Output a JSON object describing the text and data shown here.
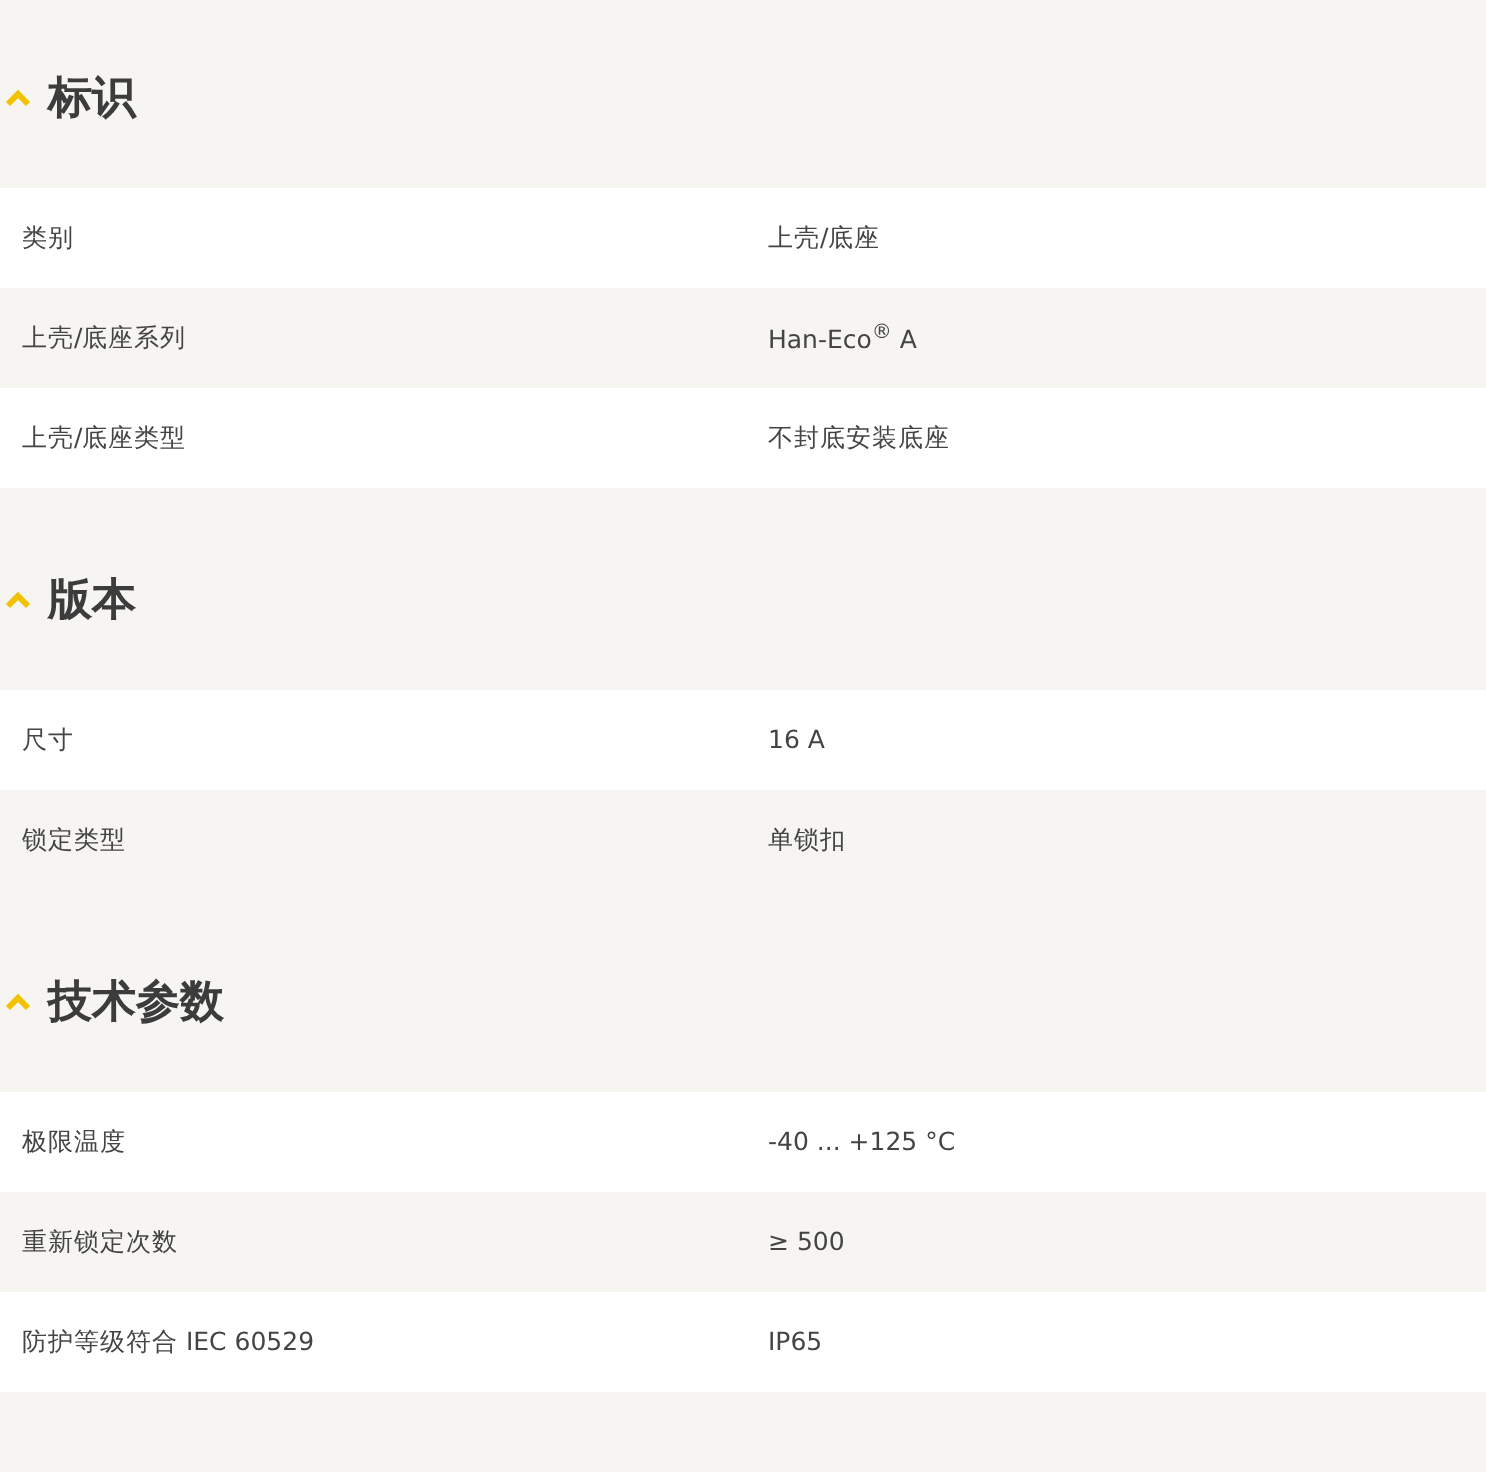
{
  "sections": [
    {
      "title": "标识",
      "expanded": true,
      "rows": [
        {
          "label": "类别",
          "value": "上壳/底座"
        },
        {
          "label": "上壳/底座系列",
          "value": "Han-Eco$^{®}$ A"
        },
        {
          "label": "上壳/底座类型",
          "value": "不封底安装底座"
        }
      ]
    },
    {
      "title": "版本",
      "expanded": true,
      "rows": [
        {
          "label": "尺寸",
          "value": "16 A"
        },
        {
          "label": "锁定类型",
          "value": "单锁扣"
        }
      ]
    },
    {
      "title": "技术参数",
      "expanded": true,
      "rows": [
        {
          "label": "极限温度",
          "value": "-40 ... +125 °C"
        },
        {
          "label": "重新锁定次数",
          "value": "≥ 500"
        },
        {
          "label": "防护等级符合 IEC 60529",
          "value": "IP65"
        }
      ]
    }
  ]
}
